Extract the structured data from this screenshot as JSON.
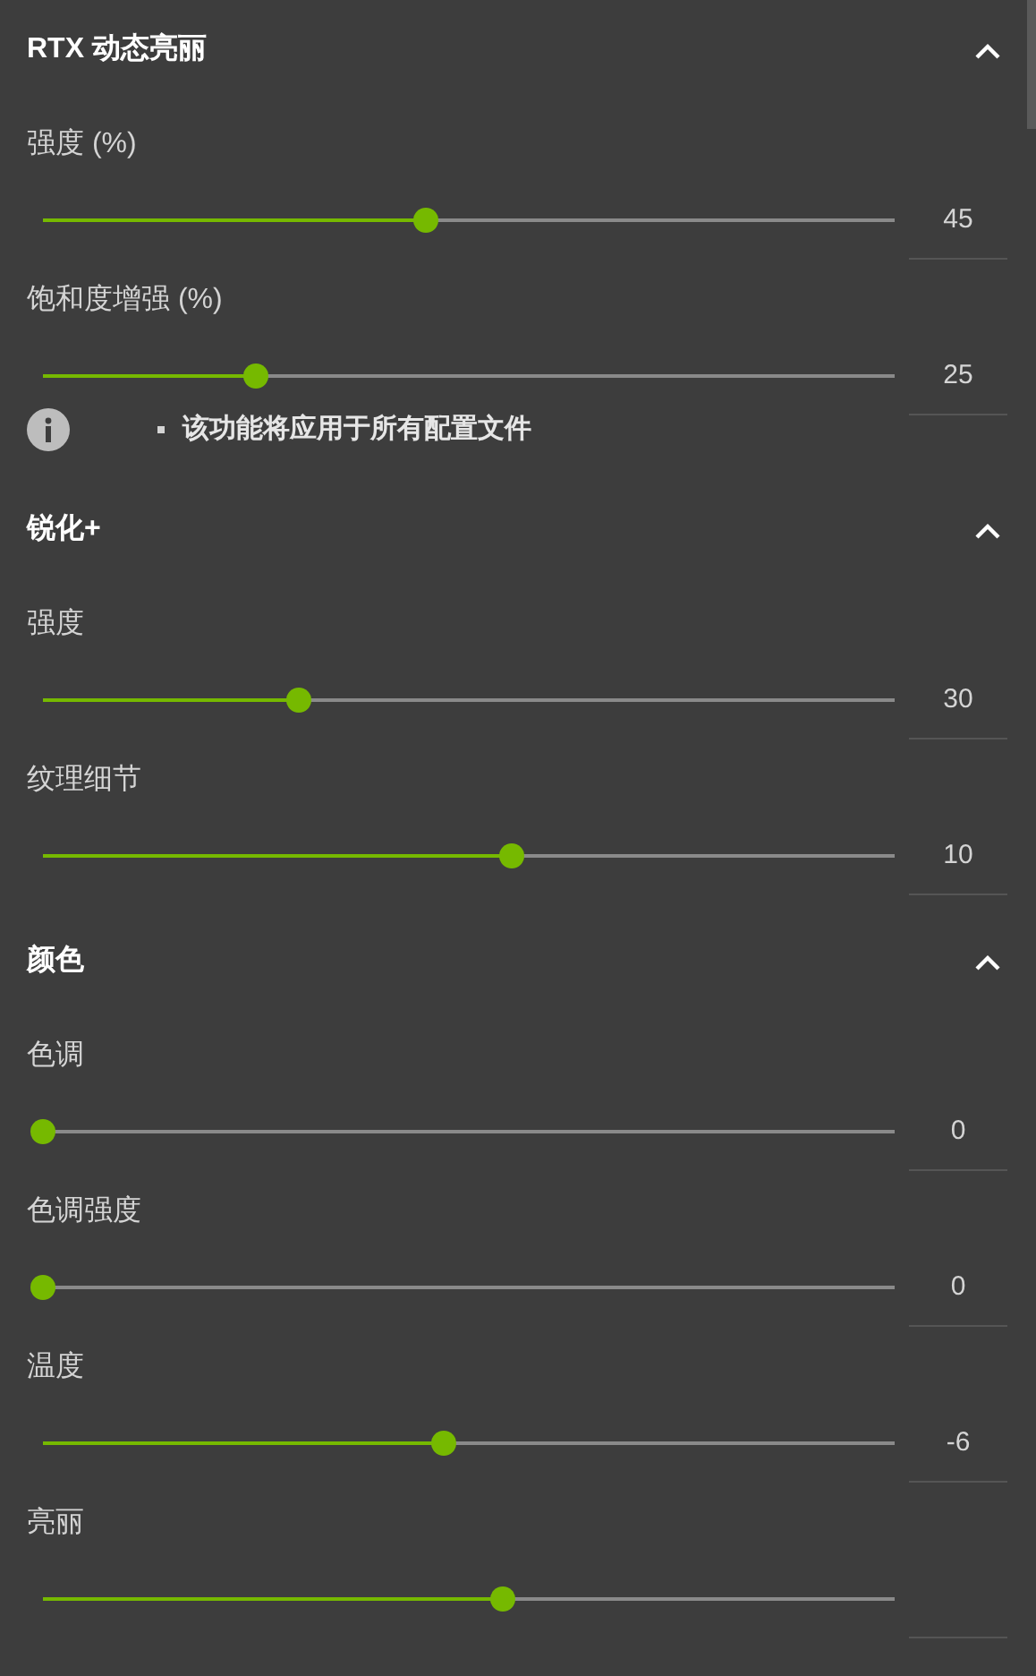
{
  "sections": [
    {
      "title": "RTX 动态亮丽",
      "expanded": true,
      "sliders": [
        {
          "label": "强度 (%)",
          "level": 0.45,
          "reading": "45"
        },
        {
          "label": "饱和度增强 (%)",
          "level": 0.25,
          "reading": "25"
        }
      ],
      "note": "该功能将应用于所有配置文件"
    },
    {
      "title": "锐化+",
      "expanded": true,
      "sliders": [
        {
          "label": "强度",
          "level": 0.3,
          "reading": "30"
        },
        {
          "label": "纹理细节",
          "level": 0.55,
          "reading": "10"
        }
      ]
    },
    {
      "title": "颜色",
      "expanded": true,
      "sliders": [
        {
          "label": "色调",
          "level": 0,
          "reading": "0"
        },
        {
          "label": "色调强度",
          "level": 0,
          "reading": "0"
        },
        {
          "label": "温度",
          "level": 0.47,
          "reading": "-6"
        },
        {
          "label": "亮丽",
          "level": 0.54
        }
      ]
    }
  ]
}
